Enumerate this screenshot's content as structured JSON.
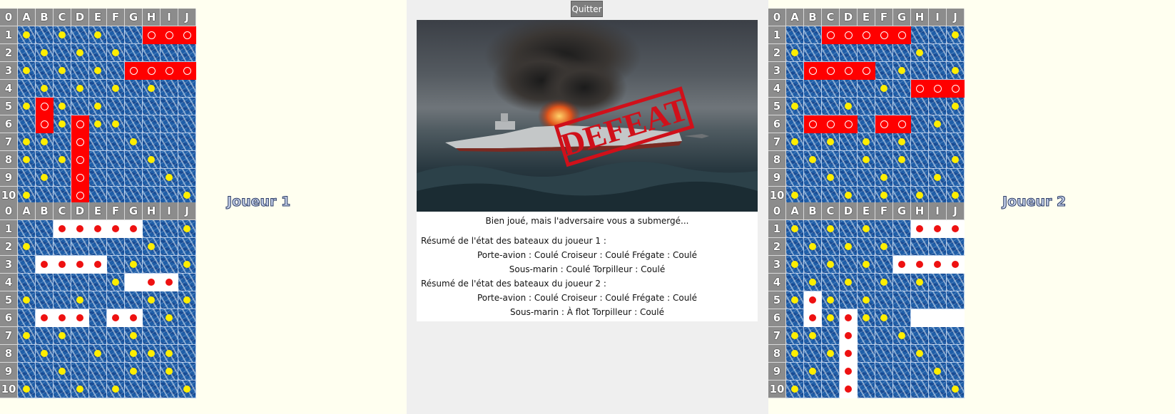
{
  "quit_label": "Quitter",
  "colors": {
    "panel_bg": "#fffff0",
    "header_bg": "#8c8c8c",
    "water": "#1f5ea8",
    "sunk_ship": "#ff0000",
    "own_ship": "#ffffff",
    "miss_marker": "#ffee00",
    "hit_marker": "#ee1111"
  },
  "grid_headers": {
    "corner": "0",
    "columns": [
      "A",
      "B",
      "C",
      "D",
      "E",
      "F",
      "G",
      "H",
      "I",
      "J"
    ],
    "rows": [
      "1",
      "2",
      "3",
      "4",
      "5",
      "6",
      "7",
      "8",
      "9",
      "10"
    ]
  },
  "player1": {
    "label": "Joueur 1",
    "top_board": {
      "ships": [
        {
          "cells": [
            "H1",
            "I1",
            "J1"
          ],
          "state": "sunk"
        },
        {
          "cells": [
            "G3",
            "H3",
            "I3",
            "J3"
          ],
          "state": "sunk"
        },
        {
          "cells": [
            "B5",
            "B6"
          ],
          "state": "sunk"
        },
        {
          "cells": [
            "D6",
            "D7",
            "D8",
            "D9",
            "D10"
          ],
          "state": "sunk"
        }
      ],
      "misses": [
        "A1",
        "C1",
        "E1",
        "B2",
        "D2",
        "F2",
        "A3",
        "C3",
        "E3",
        "B4",
        "D4",
        "F4",
        "H4",
        "A5",
        "C5",
        "E5",
        "C6",
        "E6",
        "F6",
        "A7",
        "B7",
        "G7",
        "A8",
        "C8",
        "H8",
        "B9",
        "I9",
        "A10",
        "J10"
      ]
    },
    "bottom_board": {
      "ships": [
        {
          "cells": [
            "C1",
            "D1",
            "E1",
            "F1",
            "G1"
          ],
          "state": "own"
        },
        {
          "cells": [
            "B3",
            "C3",
            "D3",
            "E3"
          ],
          "state": "own"
        },
        {
          "cells": [
            "G4",
            "H4",
            "I4"
          ],
          "state": "own"
        },
        {
          "cells": [
            "B6",
            "C6",
            "D6"
          ],
          "state": "own"
        },
        {
          "cells": [
            "F6",
            "G6"
          ],
          "state": "own"
        }
      ],
      "hits": [
        "C1",
        "D1",
        "E1",
        "F1",
        "G1",
        "B3",
        "C3",
        "D3",
        "E3",
        "H4",
        "I4",
        "B6",
        "C6",
        "D6",
        "F6",
        "G6"
      ],
      "misses": [
        "J1",
        "A2",
        "H2",
        "G3",
        "J3",
        "F4",
        "A5",
        "D5",
        "H5",
        "J5",
        "I6",
        "A7",
        "C7",
        "G7",
        "B8",
        "E8",
        "G8",
        "H8",
        "I8",
        "C9",
        "G9",
        "I9",
        "A10",
        "D10",
        "F10",
        "J10"
      ]
    }
  },
  "player2": {
    "label": "Joueur 2",
    "top_board": {
      "ships": [
        {
          "cells": [
            "C1",
            "D1",
            "E1",
            "F1",
            "G1"
          ],
          "state": "sunk"
        },
        {
          "cells": [
            "B3",
            "C3",
            "D3",
            "E3"
          ],
          "state": "sunk"
        },
        {
          "cells": [
            "H4",
            "I4",
            "J4"
          ],
          "state": "sunk"
        },
        {
          "cells": [
            "B6",
            "C6",
            "D6"
          ],
          "state": "sunk"
        },
        {
          "cells": [
            "F6",
            "G6"
          ],
          "state": "sunk"
        }
      ],
      "misses": [
        "J1",
        "A2",
        "H2",
        "G3",
        "J3",
        "F4",
        "A5",
        "D5",
        "J5",
        "I6",
        "A7",
        "C7",
        "E7",
        "G7",
        "B8",
        "E8",
        "G8",
        "J8",
        "C9",
        "F9",
        "I9",
        "A10",
        "D10",
        "F10",
        "H10",
        "J10"
      ]
    },
    "bottom_board": {
      "ships": [
        {
          "cells": [
            "H1",
            "I1",
            "J1"
          ],
          "state": "own"
        },
        {
          "cells": [
            "G3",
            "H3",
            "I3",
            "J3"
          ],
          "state": "own"
        },
        {
          "cells": [
            "B5",
            "B6"
          ],
          "state": "own"
        },
        {
          "cells": [
            "D6",
            "D7",
            "D8",
            "D9",
            "D10"
          ],
          "state": "own"
        },
        {
          "cells": [
            "H6",
            "I6",
            "J6"
          ],
          "state": "own"
        }
      ],
      "hits": [
        "H1",
        "I1",
        "J1",
        "G3",
        "H3",
        "I3",
        "J3",
        "B5",
        "B6",
        "D6",
        "D7",
        "D8",
        "D9",
        "D10"
      ],
      "misses": [
        "A1",
        "C1",
        "E1",
        "B2",
        "D2",
        "F2",
        "A3",
        "C3",
        "E3",
        "B4",
        "D4",
        "F4",
        "H4",
        "A5",
        "C5",
        "E5",
        "C6",
        "E6",
        "F6",
        "A7",
        "B7",
        "G7",
        "A8",
        "C8",
        "H8",
        "B9",
        "I9",
        "A10",
        "J10"
      ]
    }
  },
  "defeat_image": {
    "stamp_text": "DEFEAT"
  },
  "summary": {
    "message": "Bien joué, mais l'adversaire vous a submergé...",
    "player1": {
      "title": "Résumé de l'état des bateaux du joueur 1 :",
      "line1": "Porte-avion : Coulé    Croiseur : Coulé    Frégate : Coulé",
      "line2": "Sous-marin : Coulé    Torpilleur : Coulé"
    },
    "player2": {
      "title": "Résumé de l'état des bateaux du joueur 2 :",
      "line1": "Porte-avion : Coulé    Croiseur : Coulé    Frégate : Coulé",
      "line2": "Sous-marin : À flot    Torpilleur : Coulé"
    }
  }
}
